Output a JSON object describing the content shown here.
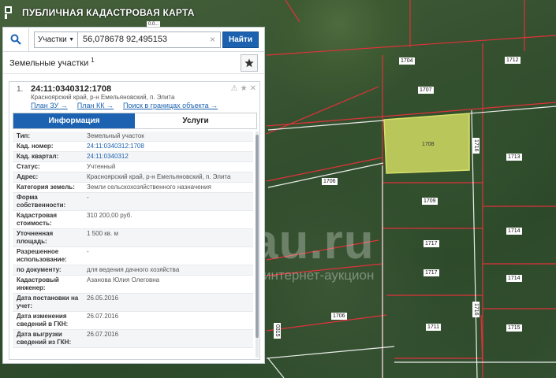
{
  "app": {
    "title": "ПУБЛИЧНАЯ КАДАСТРОВАЯ КАРТА"
  },
  "search": {
    "type_label": "Участки",
    "query": "56,078678 92,495153",
    "find_label": "Найти"
  },
  "section": {
    "title": "Земельные участки",
    "count": "1"
  },
  "result": {
    "index": "1.",
    "cad_number": "24:11:0340312:1708",
    "address": "Красноярский край, р-н Емельяновский, п. Элита",
    "links": [
      "План ЗУ →",
      "План КК →",
      "Поиск в границах объекта →"
    ]
  },
  "tabs": [
    "Информация",
    "Услуги"
  ],
  "properties": [
    {
      "k": "Тип:",
      "v": "Земельный участок"
    },
    {
      "k": "Кад. номер:",
      "v": "24:11:0340312:1708",
      "link": true
    },
    {
      "k": "Кад. квартал:",
      "v": "24:11:0340312",
      "link": true
    },
    {
      "k": "Статус:",
      "v": "Учтенный"
    },
    {
      "k": "Адрес:",
      "v": "Красноярский край, р-н Емельяновский, п. Элита"
    },
    {
      "k": "Категория земель:",
      "v": "Земли сельскохозяйственного назначения"
    },
    {
      "k": "Форма собственности:",
      "v": "-"
    },
    {
      "k": "Кадастровая стоимость:",
      "v": "310 200,00 руб."
    },
    {
      "k": "Уточненная площадь:",
      "v": "1 500 кв. м"
    },
    {
      "k": "Разрешенное использование:",
      "v": "-"
    },
    {
      "k": "по документу:",
      "v": "для ведения дачного хозяйства"
    },
    {
      "k": "Кадастровый инженер:",
      "v": "Азанова Юлия Олеговна"
    },
    {
      "k": "Дата постановки на учет:",
      "v": "26.05.2016"
    },
    {
      "k": "Дата изменения сведений в ГКН:",
      "v": "26.07.2016"
    },
    {
      "k": "Дата выгрузки сведений из ГКН:",
      "v": "26.07.2016"
    }
  ],
  "map": {
    "labels": [
      "1704",
      "1712",
      "1707",
      "1708",
      "1716",
      "1713",
      "1706",
      "1709",
      "1714",
      "1717",
      "1717",
      "1714",
      "1706",
      "1711",
      "1715",
      "1716",
      "0315",
      "0.0..."
    ],
    "selected_color": "#b9c65a"
  },
  "watermark": {
    "main": "au.ru",
    "sub": "интернет-аукцион"
  }
}
